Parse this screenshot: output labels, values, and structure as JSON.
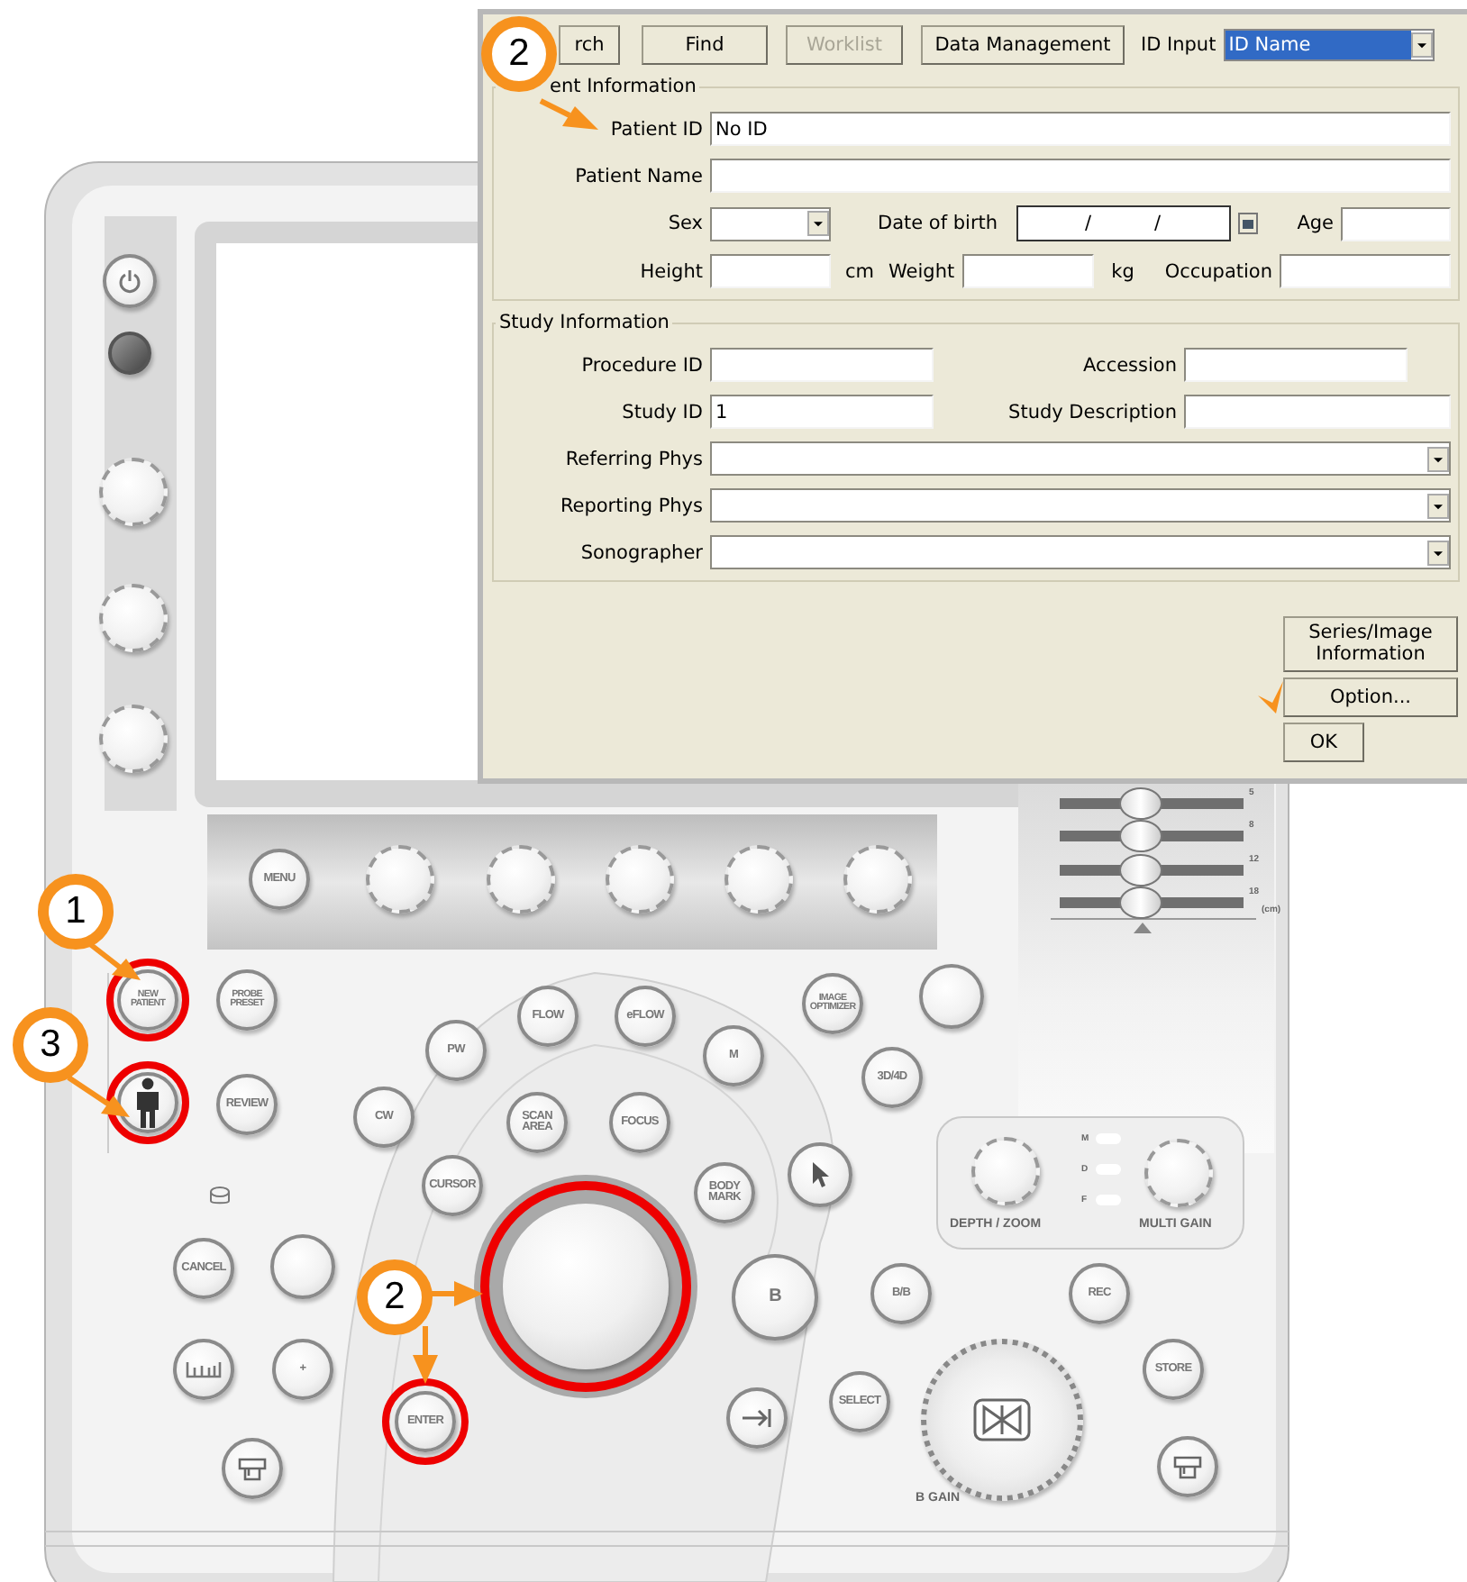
{
  "dialog": {
    "toolbar": [
      {
        "label": "rch",
        "disabled": false
      },
      {
        "label": "Find",
        "disabled": false
      },
      {
        "label": "Worklist",
        "disabled": true
      },
      {
        "label": "Data Management",
        "disabled": false
      }
    ],
    "id_input": {
      "label": "ID Input",
      "value": "ID Name"
    },
    "patient_information": {
      "legend": "ent Information",
      "patient_id": {
        "label": "Patient ID",
        "value": "No ID"
      },
      "patient_name": {
        "label": "Patient Name"
      },
      "sex": {
        "label": "Sex"
      },
      "date_of_birth": {
        "label": "Date of birth",
        "separators": [
          "/",
          "/"
        ]
      },
      "age": {
        "label": "Age"
      },
      "height": {
        "label": "Height",
        "unit": "cm"
      },
      "weight": {
        "label": "Weight",
        "unit": "kg"
      },
      "occupation": {
        "label": "Occupation"
      }
    },
    "study_information": {
      "legend": "Study Information",
      "procedure_id": {
        "label": "Procedure ID"
      },
      "accession": {
        "label": "Accession"
      },
      "study_id": {
        "label": "Study ID",
        "value": "1"
      },
      "study_description": {
        "label": "Study Description"
      },
      "referring_phys": {
        "label": "Referring Phys"
      },
      "reporting_phys": {
        "label": "Reporting Phys"
      },
      "sonographer": {
        "label": "Sonographer"
      }
    },
    "buttons": [
      "Series/Image Information",
      "Option...",
      "OK"
    ]
  },
  "console": {
    "keys": [
      "MENU",
      "NEW PATIENT",
      "PROBE PRESET",
      "REVIEW",
      "FLOW",
      "eFLOW",
      "PW",
      "M",
      "IMAGE OPTIMIZER",
      "3D/4D",
      "CW",
      "SCAN AREA",
      "FOCUS",
      "CURSOR",
      "BODY MARK",
      "CANCEL",
      "B",
      "B/B",
      "REC",
      "ENTER",
      "SELECT",
      "STORE",
      "+"
    ],
    "depth_sliders": [
      {
        "label": "5",
        "level": 0.44
      },
      {
        "label": "8",
        "level": 0.44
      },
      {
        "label": "12",
        "level": 0.44
      },
      {
        "label": "18",
        "level": 0.44
      }
    ],
    "depth_unit": "(cm)",
    "indicators": [
      "M",
      "D",
      "F"
    ],
    "dial_labels": [
      "DEPTH / ZOOM",
      "MULTI GAIN",
      "B GAIN"
    ]
  },
  "callouts": [
    "1",
    "3",
    "2",
    "2"
  ]
}
